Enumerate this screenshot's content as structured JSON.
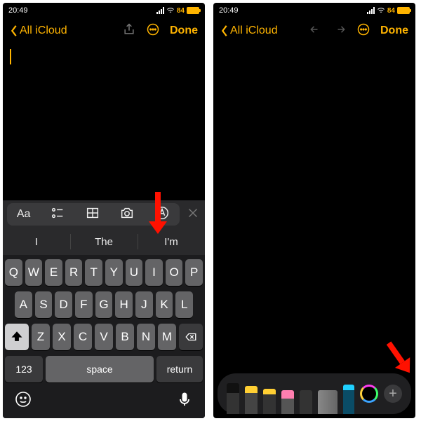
{
  "status": {
    "time": "20:49",
    "battery": "84"
  },
  "nav": {
    "back_label": "All iCloud",
    "done": "Done"
  },
  "toolbar": {
    "aa": "Aa"
  },
  "suggestions": [
    "I",
    "The",
    "I'm"
  ],
  "keyboard": {
    "row1": [
      "Q",
      "W",
      "E",
      "R",
      "T",
      "Y",
      "U",
      "I",
      "O",
      "P"
    ],
    "row2": [
      "A",
      "S",
      "D",
      "F",
      "G",
      "H",
      "J",
      "K",
      "L"
    ],
    "row3": [
      "Z",
      "X",
      "C",
      "V",
      "B",
      "N",
      "M"
    ],
    "numkey": "123",
    "space": "space",
    "return": "return"
  },
  "sketch": {
    "add": "+"
  }
}
